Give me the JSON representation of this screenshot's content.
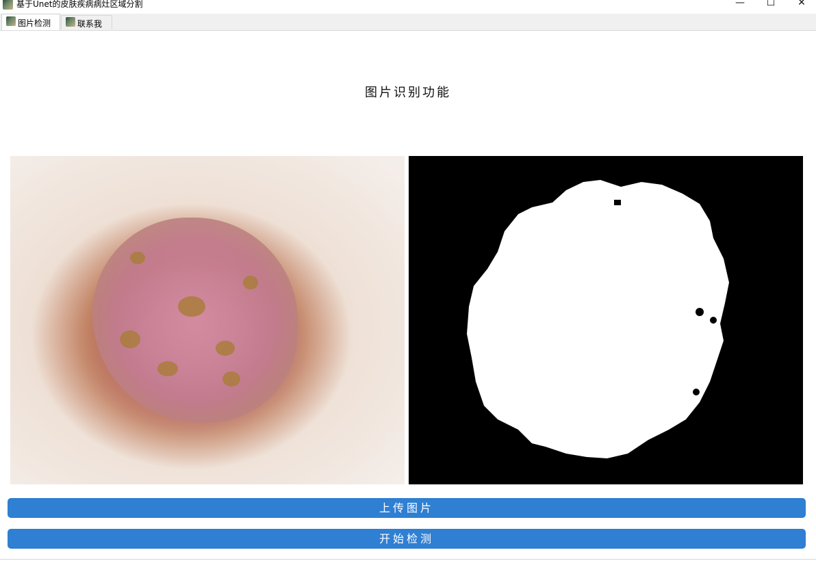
{
  "window": {
    "title": "基于Unet的皮肤疾病病灶区域分割",
    "minimize_glyph": "—",
    "maximize_glyph": "☐",
    "close_glyph": "✕",
    "app_icon": "person-photo-icon"
  },
  "tabs": [
    {
      "label": "图片检测",
      "active": true,
      "icon": "person-photo-icon"
    },
    {
      "label": "联系我",
      "active": false,
      "icon": "person-photo-icon"
    }
  ],
  "main": {
    "title": "图片识别功能",
    "input_image": "skin-lesion-photo",
    "output_image": "segmentation-mask",
    "upload_button": "上传图片",
    "detect_button": "开始检测"
  },
  "colors": {
    "accent": "#2f7fd3",
    "mask_foreground": "#ffffff",
    "mask_background": "#000000"
  }
}
